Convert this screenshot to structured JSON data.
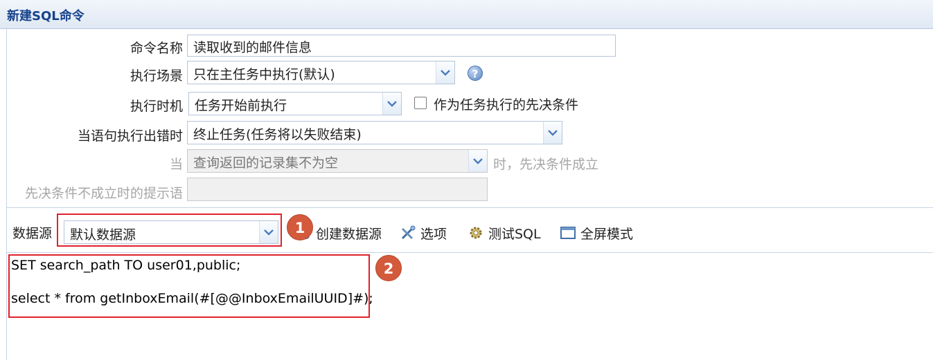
{
  "window": {
    "title": "新建SQL命令"
  },
  "form": {
    "command_name_label": "命令名称",
    "command_name_value": "读取收到的邮件信息",
    "exec_scene_label": "执行场景",
    "exec_scene_value": "只在主任务中执行(默认)",
    "exec_timing_label": "执行时机",
    "exec_timing_value": "任务开始前执行",
    "precondition_checkbox_label": "作为任务执行的先决条件",
    "precondition_checked": false,
    "on_error_label": "当语句执行出错时",
    "on_error_value": "终止任务(任务将以失败结束)",
    "when_label": "当",
    "when_value": "查询返回的记录集不为空",
    "when_suffix": "时，先决条件成立",
    "fail_hint_label": "先决条件不成立时的提示语",
    "fail_hint_value": ""
  },
  "toolbar": {
    "datasource_label": "数据源",
    "datasource_value": "默认数据源",
    "create_datasource": "创建数据源",
    "options": "选项",
    "test_sql": "测试SQL",
    "fullscreen": "全屏模式"
  },
  "editor": {
    "lines": [
      "SET search_path TO user01,public;",
      "",
      "select * from getInboxEmail(#[@@InboxEmailUUID]#);"
    ]
  },
  "annotations": {
    "badge1": "1",
    "badge2": "2"
  },
  "icons": {
    "help": "help-icon",
    "dropdown": "chevron-down-icon",
    "create_datasource": "create-datasource-icon",
    "options": "tools-icon",
    "test_sql": "gear-icon",
    "fullscreen": "window-icon"
  },
  "colors": {
    "annotation_red": "#e0212c",
    "badge_orange": "#d45a3c",
    "title_blue": "#15428b"
  }
}
